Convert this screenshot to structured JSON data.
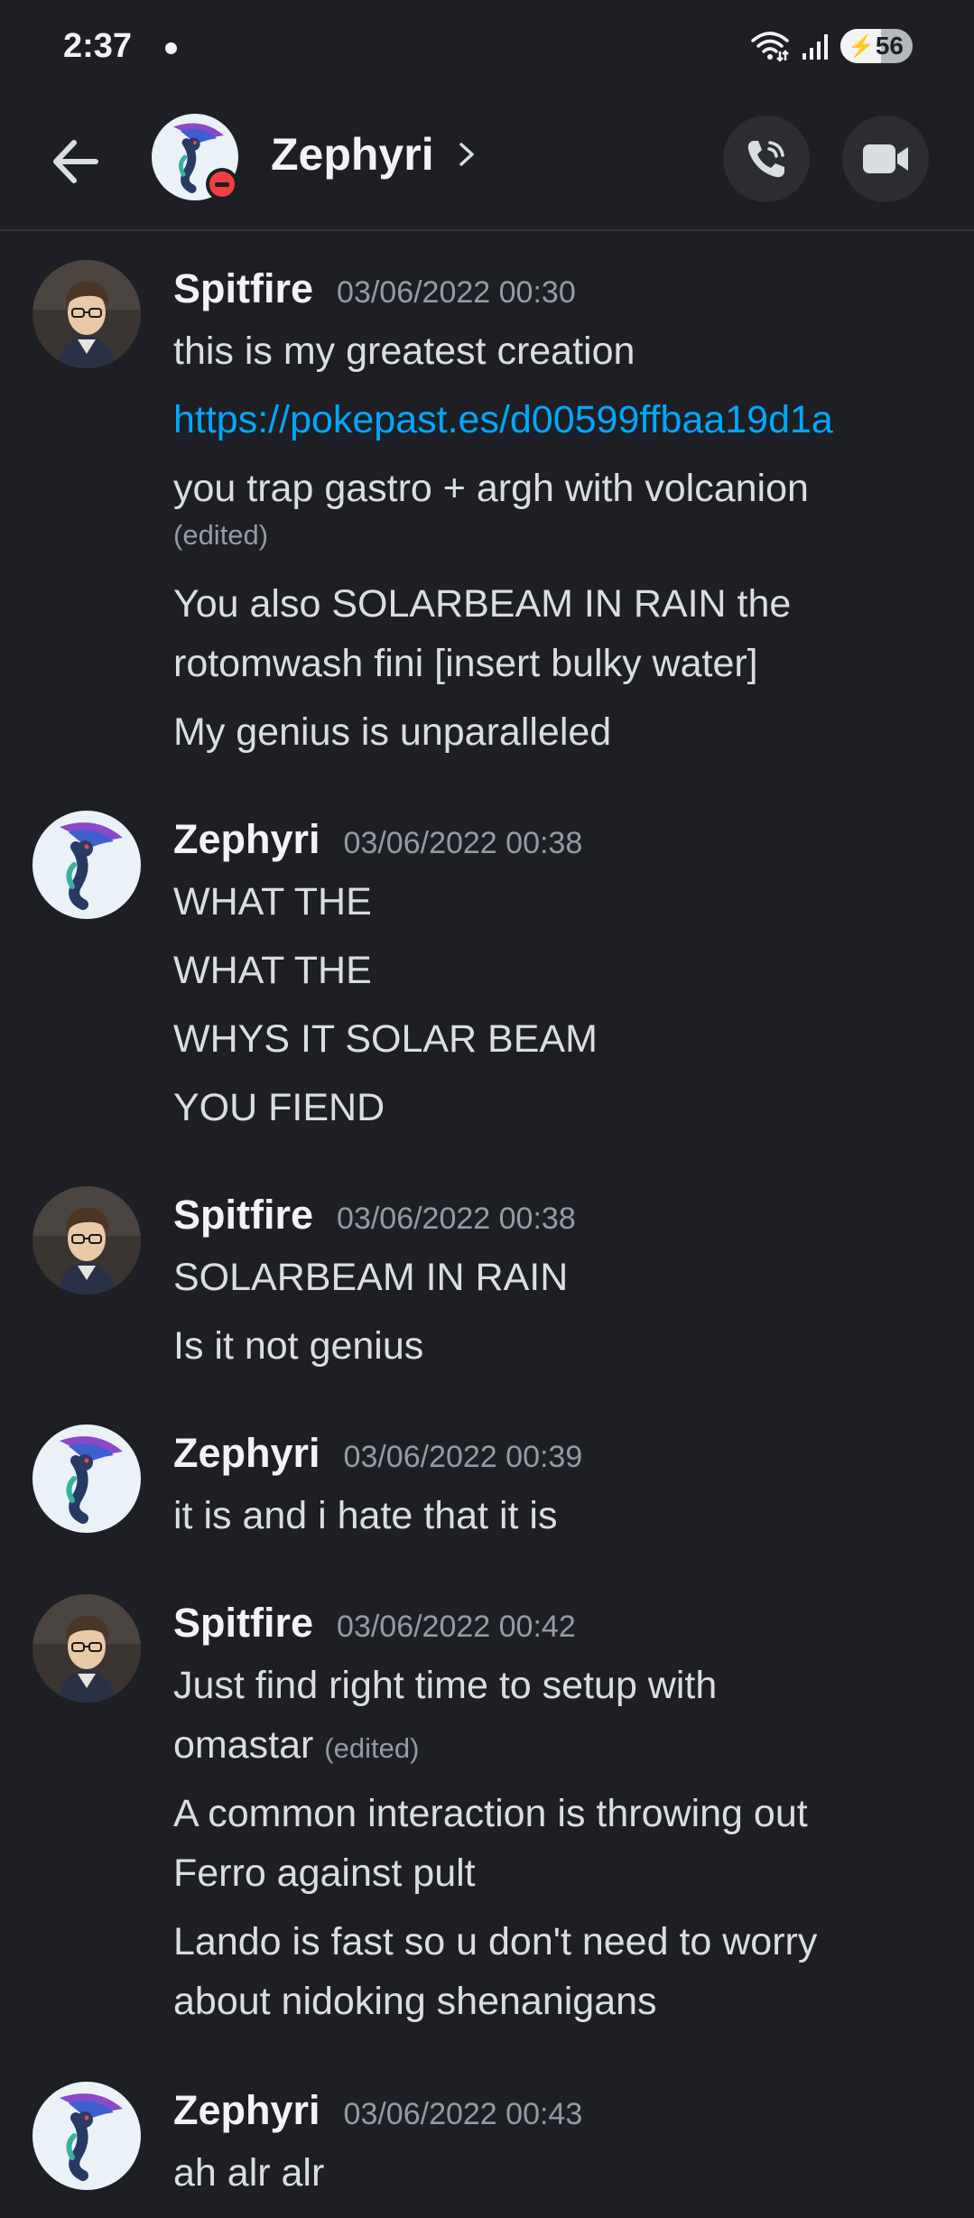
{
  "status_bar": {
    "time": "2:37",
    "battery": "56"
  },
  "header": {
    "title": "Zephyri",
    "status": "do-not-disturb"
  },
  "messages": [
    {
      "author": "Spitfire",
      "timestamp": "03/06/2022 00:30",
      "lines": [
        "this is my greatest creation",
        "https://pokepast.es/d00599ffbaa19d1a",
        "you trap gastro + argh with volcanion",
        "(edited)",
        "You also SOLARBEAM IN RAIN the",
        "rotomwash fini [insert bulky water]",
        "My genius is unparalleled"
      ]
    },
    {
      "author": "Zephyri",
      "timestamp": "03/06/2022 00:38",
      "lines": [
        "WHAT THE",
        "WHAT THE",
        "WHYS IT SOLAR BEAM",
        "YOU FIEND"
      ]
    },
    {
      "author": "Spitfire",
      "timestamp": "03/06/2022 00:38",
      "lines": [
        "SOLARBEAM IN RAIN",
        "Is it not genius"
      ]
    },
    {
      "author": "Zephyri",
      "timestamp": "03/06/2022 00:39",
      "lines": [
        "it is and i hate that it is"
      ]
    },
    {
      "author": "Spitfire",
      "timestamp": "03/06/2022 00:42",
      "lines": [
        "Just find right time to setup with",
        "omastar",
        "(edited)",
        "A common interaction is throwing out",
        "Ferro against pult",
        "Lando is fast so u don't need to worry",
        "about nidoking shenanigans"
      ]
    },
    {
      "author": "Zephyri",
      "timestamp": "03/06/2022 00:43",
      "lines": [
        "ah alr alr"
      ]
    }
  ],
  "colors": {
    "background": "#1e1f24",
    "text": "#dbdee1",
    "muted": "#949ba4",
    "link": "#00a8fc",
    "dnd": "#f23f43"
  }
}
